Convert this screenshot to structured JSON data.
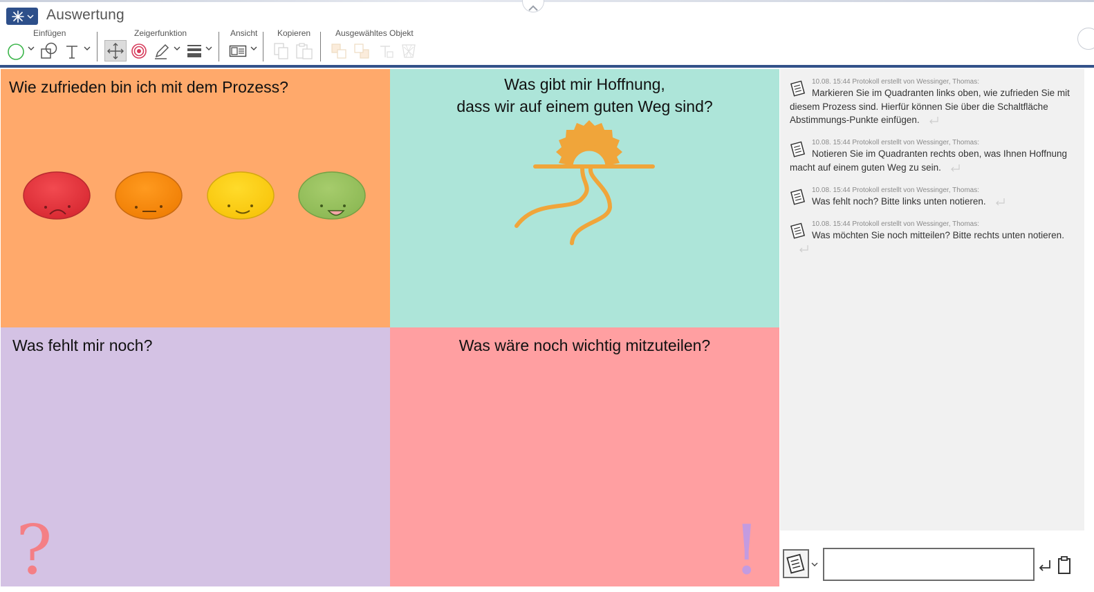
{
  "app": {
    "title": "Auswertung"
  },
  "toolbar": {
    "groups": {
      "insert": "Einfügen",
      "pointer": "Zeigerfunktion",
      "view": "Ansicht",
      "copy": "Kopieren",
      "selected": "Ausgewähltes Objekt"
    },
    "icons": {
      "insert": [
        "circle-shape-icon",
        "shapes-icon",
        "text-tool-icon"
      ],
      "pointer": [
        "move-pointer-icon",
        "target-pointer-icon",
        "pen-icon",
        "line-width-icon"
      ],
      "view": [
        "view-layout-icon"
      ],
      "copy": [
        "copy-icon",
        "paste-icon"
      ],
      "selected": [
        "bring-front-icon",
        "send-back-icon",
        "text-format-icon",
        "delete-object-icon"
      ]
    }
  },
  "quadrants": {
    "q1": {
      "title": "Wie zufrieden bin ich mit dem Prozess?",
      "color": "#ffa96b"
    },
    "q2": {
      "title_line1": "Was gibt mir Hoffnung,",
      "title_line2": "dass wir auf einem guten Weg sind?",
      "color": "#ade5d9"
    },
    "q3": {
      "title": "Was fehlt mir noch?",
      "color": "#d4c2e4",
      "symbol": "?"
    },
    "q4": {
      "title": "Was wäre noch wichtig mitzuteilen?",
      "color": "#ff9fa1",
      "symbol": "!"
    }
  },
  "faces": [
    {
      "name": "red-face",
      "mood": "unzufrieden",
      "color": "#e5383f"
    },
    {
      "name": "orange-face",
      "mood": "neutral",
      "color": "#fb8c0c"
    },
    {
      "name": "yellow-face",
      "mood": "zufrieden",
      "color": "#fed016"
    },
    {
      "name": "green-face",
      "mood": "sehr zufrieden",
      "color": "#9bc461"
    }
  ],
  "protocol": {
    "entries": [
      {
        "meta": "10.08. 15:44 Protokoll erstellt von Wessinger, Thomas:",
        "text": "Markieren Sie im Quadranten links oben, wie zufrieden Sie mit diesem Prozess sind. Hierfür können Sie über die Schaltfläche Abstimmungs-Punkte einfügen."
      },
      {
        "meta": "10.08. 15:44 Protokoll erstellt von Wessinger, Thomas:",
        "text": "Notieren Sie im Quadranten rechts oben, was Ihnen Hoffnung macht auf einem guten Weg zu sein."
      },
      {
        "meta": "10.08. 15:44 Protokoll erstellt von Wessinger, Thomas:",
        "text": "Was fehlt noch? Bitte links unten notieren."
      },
      {
        "meta": "10.08. 15:44 Protokoll erstellt von Wessinger, Thomas:",
        "text": "Was möchten Sie noch mitteilen? Bitte rechts unten notieren."
      }
    ]
  },
  "input": {
    "value": "",
    "placeholder": ""
  },
  "colors": {
    "accent": "#33528a",
    "sun": "#f0a53a"
  }
}
